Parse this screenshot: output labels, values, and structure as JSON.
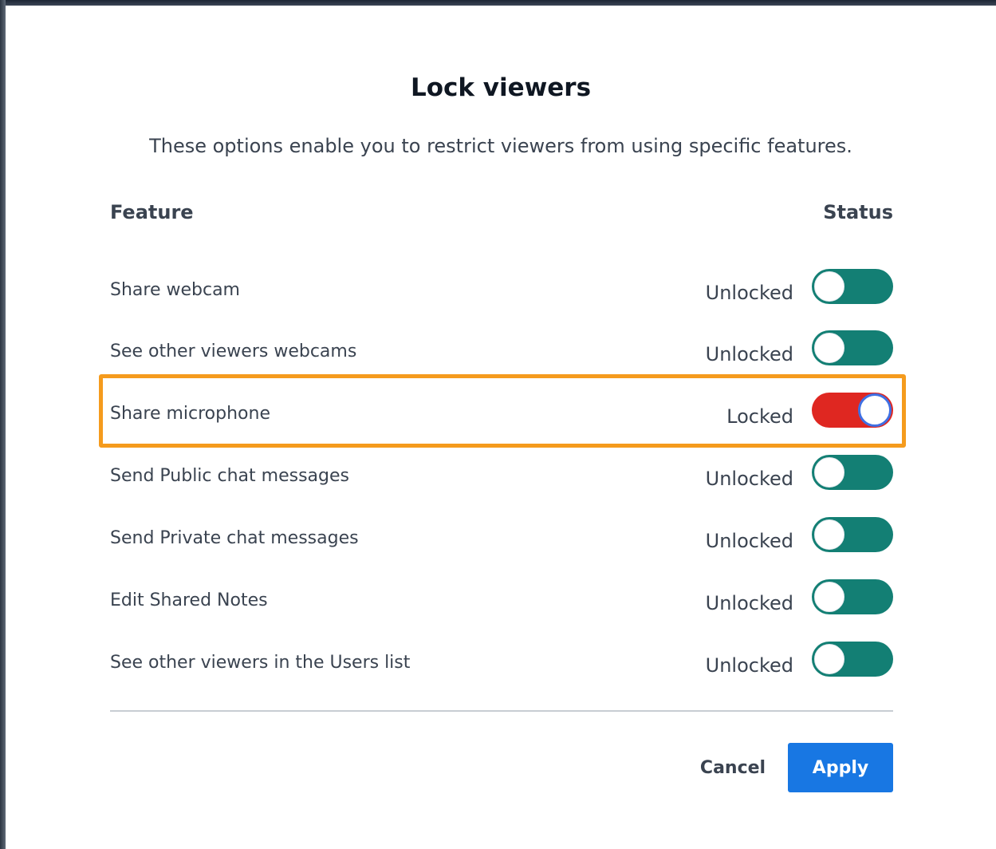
{
  "dialog": {
    "title": "Lock viewers",
    "description": "These options enable you to restrict viewers from using specific features."
  },
  "table": {
    "feature_header": "Feature",
    "status_header": "Status",
    "rows": [
      {
        "label": "Share webcam",
        "status": "Unlocked",
        "locked": false
      },
      {
        "label": "See other viewers webcams",
        "status": "Unlocked",
        "locked": false
      },
      {
        "label": "Share microphone",
        "status": "Locked",
        "locked": true
      },
      {
        "label": "Send Public chat messages",
        "status": "Unlocked",
        "locked": false
      },
      {
        "label": "Send Private chat messages",
        "status": "Unlocked",
        "locked": false
      },
      {
        "label": "Edit Shared Notes",
        "status": "Unlocked",
        "locked": false
      },
      {
        "label": "See other viewers in the Users list",
        "status": "Unlocked",
        "locked": false
      }
    ]
  },
  "actions": {
    "cancel_label": "Cancel",
    "apply_label": "Apply"
  },
  "colors": {
    "unlocked_toggle": "#137f74",
    "locked_toggle": "#df2721",
    "highlight": "#f59b1d",
    "primary": "#1877e3"
  }
}
